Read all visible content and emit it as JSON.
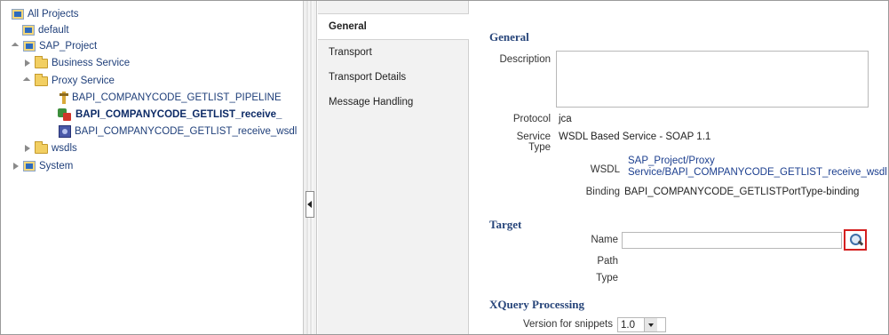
{
  "tree": {
    "items": [
      {
        "label": "All Projects",
        "icon": "project-icon",
        "twisty": "none",
        "selected": false
      },
      {
        "label": "default",
        "icon": "project-icon",
        "twisty": "none",
        "selected": false
      },
      {
        "label": "SAP_Project",
        "icon": "project-icon",
        "twisty": "open",
        "selected": false
      },
      {
        "label": "Business Service",
        "icon": "folder-icon",
        "twisty": "closed",
        "selected": false
      },
      {
        "label": "Proxy Service",
        "icon": "folder-icon",
        "twisty": "open",
        "selected": false
      },
      {
        "label": "BAPI_COMPANYCODE_GETLIST_PIPELINE",
        "icon": "pipeline-icon",
        "twisty": "none",
        "selected": false
      },
      {
        "label": "BAPI_COMPANYCODE_GETLIST_receive_",
        "icon": "proxy-service-icon",
        "twisty": "none",
        "selected": true
      },
      {
        "label": "BAPI_COMPANYCODE_GETLIST_receive_wsdl",
        "icon": "wsdl-icon",
        "twisty": "none",
        "selected": false
      },
      {
        "label": "wsdls",
        "icon": "folder-icon",
        "twisty": "closed",
        "selected": false
      },
      {
        "label": "System",
        "icon": "project-icon",
        "twisty": "closed",
        "selected": false
      }
    ]
  },
  "tabs": {
    "items": [
      {
        "label": "General",
        "active": true
      },
      {
        "label": "Transport",
        "active": false
      },
      {
        "label": "Transport Details",
        "active": false
      },
      {
        "label": "Message Handling",
        "active": false
      }
    ]
  },
  "general": {
    "heading": "General",
    "description_label": "Description",
    "description_value": "",
    "protocol_label": "Protocol",
    "protocol_value": "jca",
    "service_type_label_1": "Service",
    "service_type_label_2": "Type",
    "service_type_value": "WSDL Based Service - SOAP 1.1",
    "wsdl_label": "WSDL",
    "wsdl_link_1": "SAP_Project/Proxy",
    "wsdl_link_2": "Service/BAPI_COMPANYCODE_GETLIST_receive_wsdl",
    "binding_label": "Binding",
    "binding_value": "BAPI_COMPANYCODE_GETLISTPortType-binding"
  },
  "target": {
    "heading": "Target",
    "name_label": "Name",
    "name_value": "",
    "path_label": "Path",
    "type_label": "Type"
  },
  "xquery": {
    "heading": "XQuery Processing",
    "version_label": "Version for snippets",
    "version_value": "1.0"
  },
  "colors": {
    "tree_text": "#1f3f7a",
    "section_heading": "#27457a",
    "link": "#1c3f8f",
    "highlight_box": "#d42020"
  }
}
